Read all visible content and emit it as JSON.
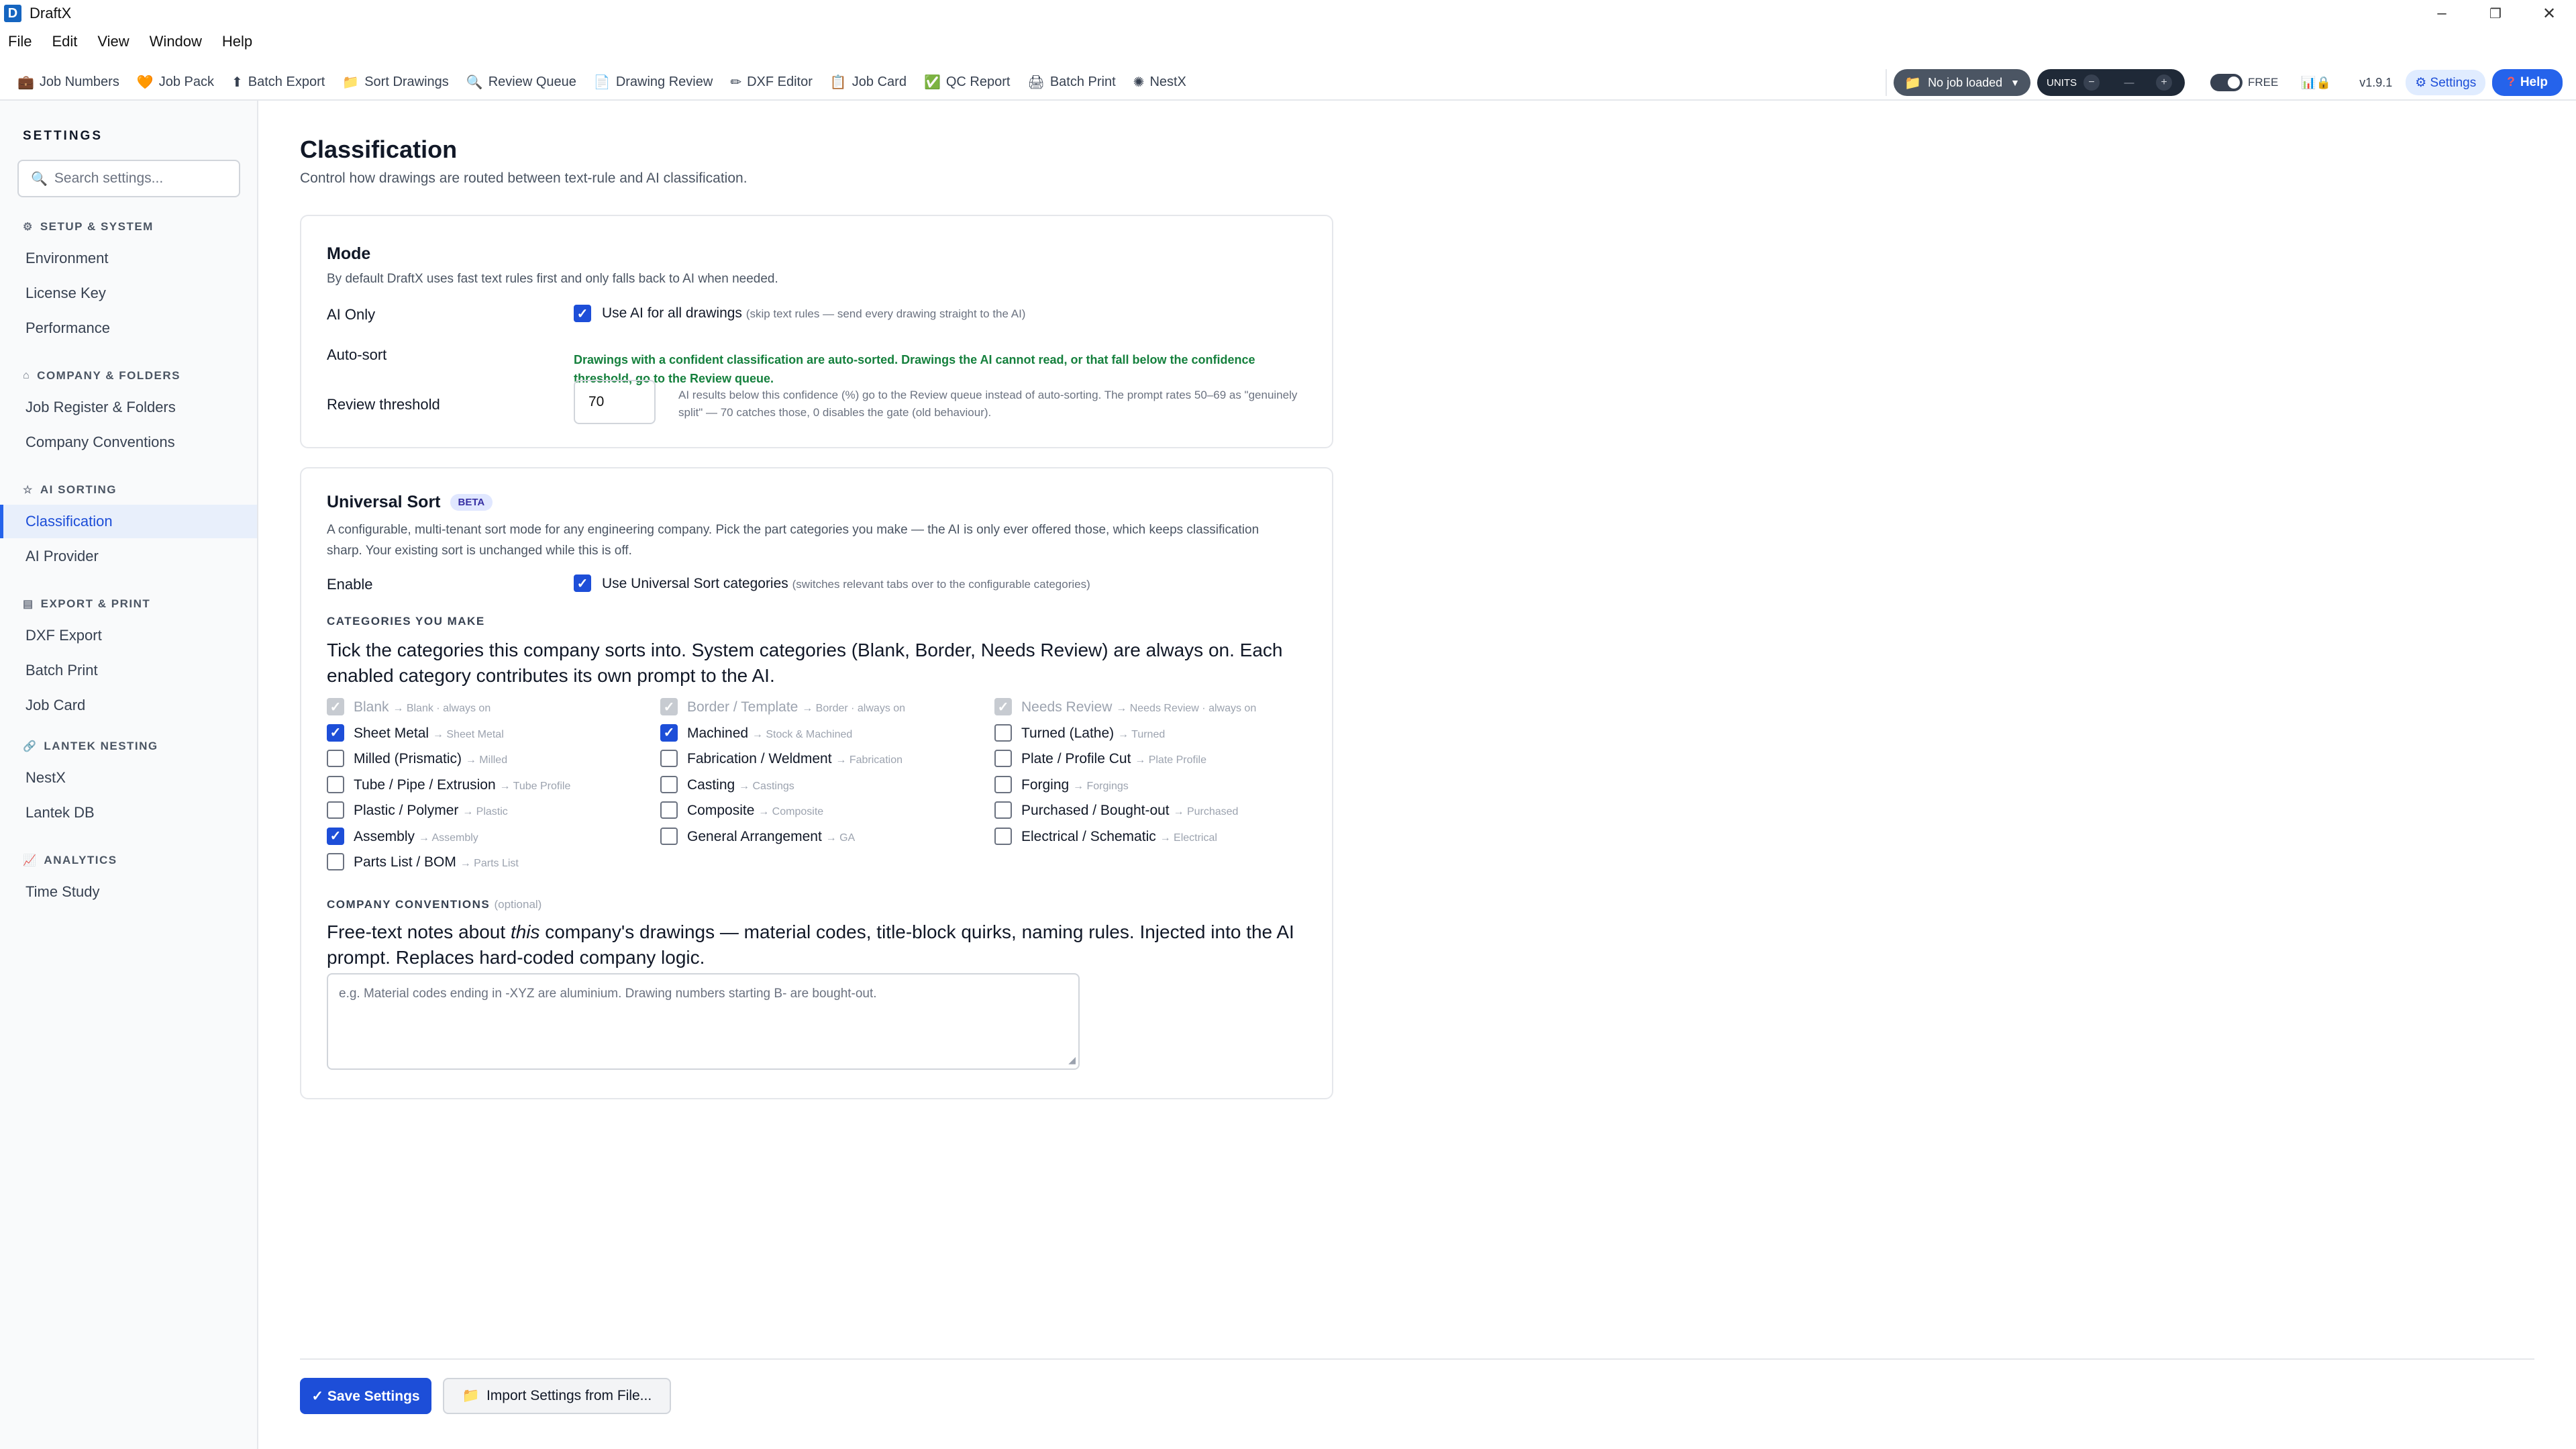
{
  "window": {
    "title": "DraftX",
    "logo_letter": "D",
    "minimize": "–",
    "maximize": "❐",
    "close": "✕"
  },
  "menu": [
    "File",
    "Edit",
    "View",
    "Window",
    "Help"
  ],
  "toolbar": {
    "items": [
      {
        "icon": "briefcase-icon",
        "glyph": "💼",
        "label": "Job Numbers"
      },
      {
        "icon": "pack-icon",
        "glyph": "🧡",
        "label": "Job Pack"
      },
      {
        "icon": "export-icon",
        "glyph": "⬆",
        "label": "Batch Export"
      },
      {
        "icon": "folder-icon",
        "glyph": "📁",
        "label": "Sort Drawings"
      },
      {
        "icon": "magnifier-icon",
        "glyph": "🔍",
        "label": "Review Queue"
      },
      {
        "icon": "document-icon",
        "glyph": "📄",
        "label": "Drawing Review"
      },
      {
        "icon": "pencil-icon",
        "glyph": "✏",
        "label": "DXF Editor"
      },
      {
        "icon": "clipboard-icon",
        "glyph": "📋",
        "label": "Job Card"
      },
      {
        "icon": "check-icon",
        "glyph": "✅",
        "label": "QC Report"
      },
      {
        "icon": "printer-icon",
        "glyph": "🖨",
        "label": "Batch Print"
      },
      {
        "icon": "sun-icon",
        "glyph": "✺",
        "label": "NestX"
      }
    ],
    "job_selector": "No job loaded",
    "units_label": "UNITS",
    "units_minus": "−",
    "units_value": "—",
    "units_plus": "+",
    "free_label": "FREE",
    "version": "v1.9.1",
    "settings_label": "⚙ Settings",
    "help_label": "Help",
    "help_glyph": "?"
  },
  "sidebar": {
    "title": "SETTINGS",
    "search_placeholder": "Search settings...",
    "sections": [
      {
        "title": "SETUP & SYSTEM",
        "icon": "gear-icon",
        "glyph": "⚙",
        "items": [
          "Environment",
          "License Key",
          "Performance"
        ]
      },
      {
        "title": "COMPANY & FOLDERS",
        "icon": "building-icon",
        "glyph": "⌂",
        "items": [
          "Job Register & Folders",
          "Company Conventions"
        ]
      },
      {
        "title": "AI SORTING",
        "icon": "star-icon",
        "glyph": "☆",
        "items": [
          "Classification",
          "AI Provider"
        ]
      },
      {
        "title": "EXPORT & PRINT",
        "icon": "export-box-icon",
        "glyph": "▤",
        "items": [
          "DXF Export",
          "Batch Print",
          "Job Card"
        ]
      },
      {
        "title": "LANTEK NESTING",
        "icon": "link-icon",
        "glyph": "🔗",
        "items": [
          "NestX",
          "Lantek DB"
        ]
      },
      {
        "title": "ANALYTICS",
        "icon": "chart-icon",
        "glyph": "📈",
        "items": [
          "Time Study"
        ]
      }
    ],
    "active_item": "Classification"
  },
  "page": {
    "title": "Classification",
    "subtitle": "Control how drawings are routed between text-rule and AI classification."
  },
  "mode_card": {
    "title": "Mode",
    "desc": "By default DraftX uses fast text rules first and only falls back to AI when needed.",
    "ai_only_label": "AI Only",
    "ai_only_checked": true,
    "ai_only_text": "Use AI for all drawings",
    "ai_only_hint": "(skip text rules — send every drawing straight to the AI)",
    "autosort_label": "Auto-sort",
    "autosort_note": "Drawings with a confident classification are auto-sorted. Drawings the AI cannot read, or that fall below the confidence threshold, go to the Review queue.",
    "threshold_label": "Review threshold",
    "threshold_value": "70",
    "threshold_note": "AI results below this confidence (%) go to the Review queue instead of auto-sorting. The prompt rates 50–69 as \"genuinely split\" — 70 catches those, 0 disables the gate (old behaviour)."
  },
  "universal_card": {
    "title": "Universal Sort",
    "badge": "BETA",
    "desc": "A configurable, multi-tenant sort mode for any engineering company. Pick the part categories you make — the AI is only ever offered those, which keeps classification sharp. Your existing sort is unchanged while this is off.",
    "enable_label": "Enable",
    "enable_checked": true,
    "enable_text": "Use Universal Sort categories",
    "enable_hint": "(switches relevant tabs over to the configurable categories)",
    "categories_heading": "CATEGORIES YOU MAKE",
    "categories_text": "Tick the categories this company sorts into. System categories (Blank, Border, Needs Review) are always on. Each enabled category contributes its own prompt to the AI.",
    "categories": [
      [
        {
          "label": "Blank",
          "target": "→ Blank · always on",
          "state": "disabled"
        },
        {
          "label": "Sheet Metal",
          "target": "→ Sheet Metal",
          "state": "on"
        },
        {
          "label": "Milled (Prismatic)",
          "target": "→ Milled",
          "state": "off"
        },
        {
          "label": "Tube / Pipe / Extrusion",
          "target": "→ Tube Profile",
          "state": "off"
        },
        {
          "label": "Plastic / Polymer",
          "target": "→ Plastic",
          "state": "off"
        },
        {
          "label": "Assembly",
          "target": "→ Assembly",
          "state": "on"
        },
        {
          "label": "Parts List / BOM",
          "target": "→ Parts List",
          "state": "off"
        }
      ],
      [
        {
          "label": "Border / Template",
          "target": "→ Border · always on",
          "state": "disabled"
        },
        {
          "label": "Machined",
          "target": "→ Stock & Machined",
          "state": "on"
        },
        {
          "label": "Fabrication / Weldment",
          "target": "→ Fabrication",
          "state": "off"
        },
        {
          "label": "Casting",
          "target": "→ Castings",
          "state": "off"
        },
        {
          "label": "Composite",
          "target": "→ Composite",
          "state": "off"
        },
        {
          "label": "General Arrangement",
          "target": "→ GA",
          "state": "off"
        }
      ],
      [
        {
          "label": "Needs Review",
          "target": "→ Needs Review · always on",
          "state": "disabled"
        },
        {
          "label": "Turned (Lathe)",
          "target": "→ Turned",
          "state": "off"
        },
        {
          "label": "Plate / Profile Cut",
          "target": "→ Plate Profile",
          "state": "off"
        },
        {
          "label": "Forging",
          "target": "→ Forgings",
          "state": "off"
        },
        {
          "label": "Purchased / Bought-out",
          "target": "→ Purchased",
          "state": "off"
        },
        {
          "label": "Electrical / Schematic",
          "target": "→ Electrical",
          "state": "off"
        }
      ]
    ],
    "conventions_heading": "COMPANY CONVENTIONS",
    "conventions_optional": "(optional)",
    "conventions_text_before": "Free-text notes about ",
    "conventions_text_em": "this",
    "conventions_text_after": " company's drawings — material codes, title-block quirks, naming rules. Injected into the AI prompt. Replaces hard-coded company logic.",
    "conventions_placeholder": "e.g. Material codes ending in -XYZ are aluminium. Drawing numbers starting B- are bought-out."
  },
  "footer": {
    "save_label": "✓ Save Settings",
    "import_label": "Import Settings from File..."
  }
}
